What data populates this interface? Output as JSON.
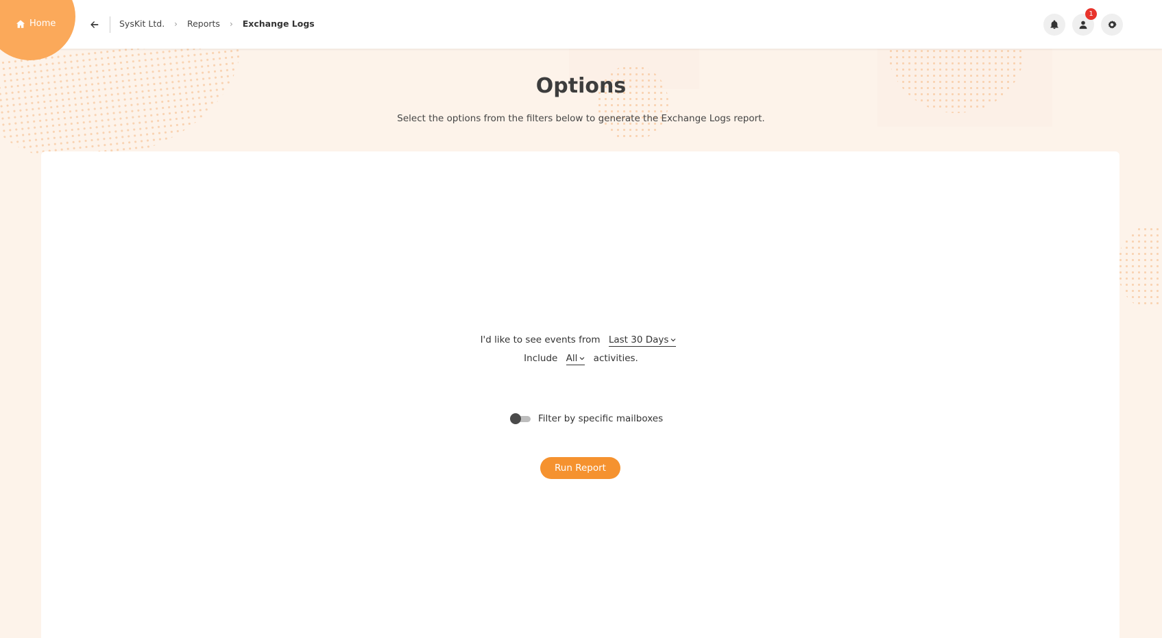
{
  "header": {
    "home_label": "Home",
    "breadcrumb": [
      "SysKit Ltd.",
      "Reports",
      "Exchange Logs"
    ],
    "notification_badge": "1"
  },
  "main": {
    "title": "Options",
    "subtitle": "Select the options from the filters below to generate the Exchange Logs report.",
    "events_prefix": "I'd like to see events from",
    "period_value": "Last 30 Days",
    "include_prefix": "Include",
    "activities_value": "All",
    "include_suffix": "activities.",
    "toggle_label": "Filter by specific mailboxes",
    "toggle_on": false,
    "run_button": "Run Report"
  },
  "colors": {
    "accent": "#f5922f",
    "home_blob": "#fba95a",
    "background": "#fdf3ea",
    "badge": "#e8332b"
  }
}
